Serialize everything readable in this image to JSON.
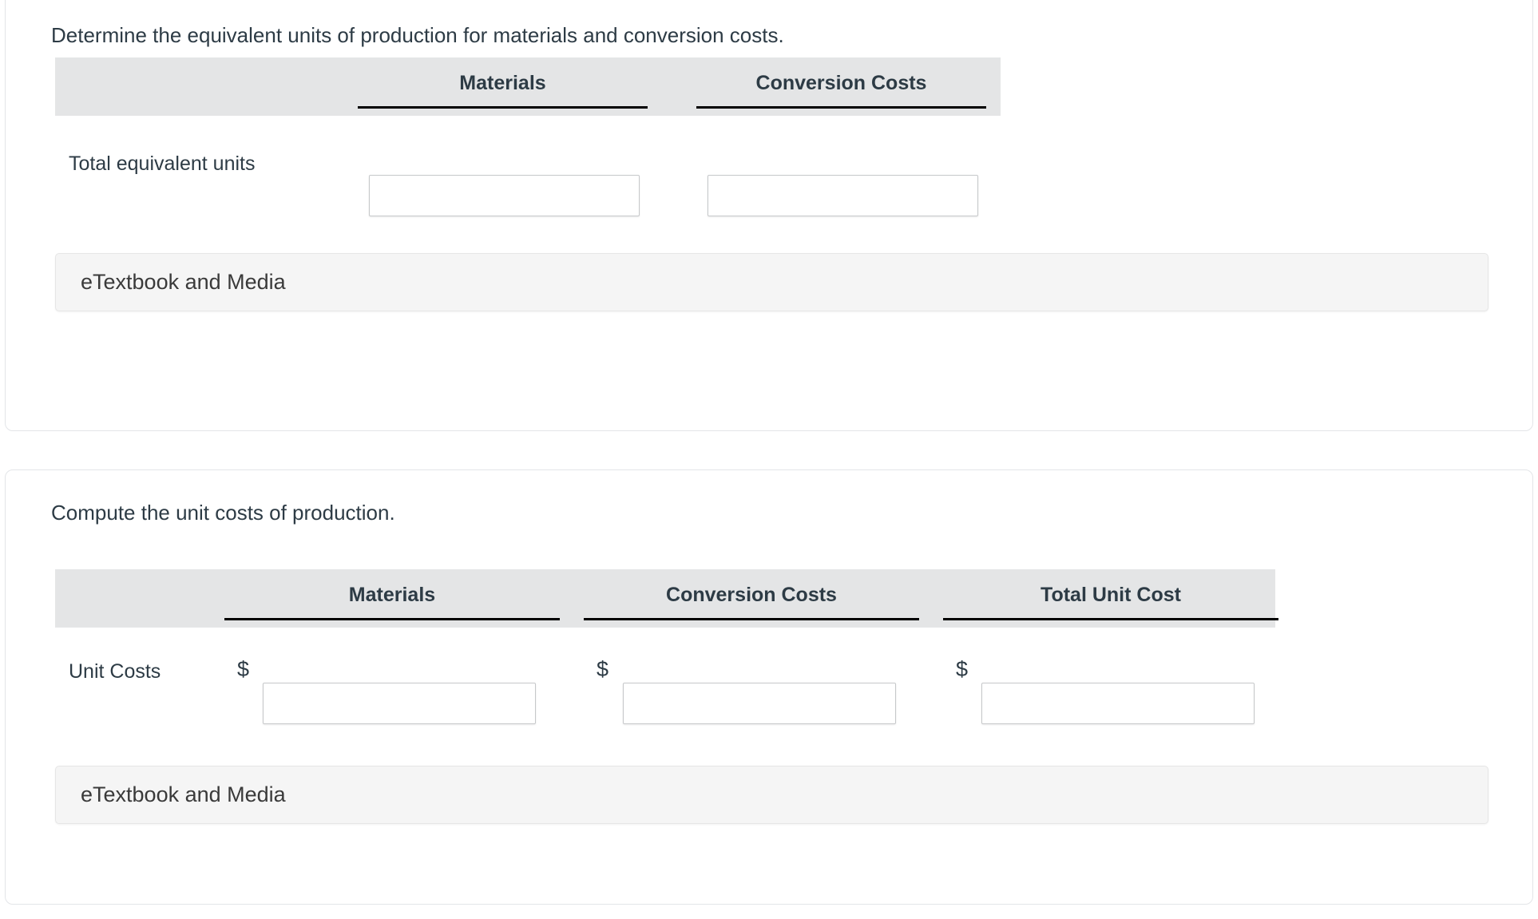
{
  "theme": {
    "text_color": "#2d3b45",
    "header_bg": "#e4e5e6",
    "card_border": "#e3e5e8",
    "input_border": "#c6c8ca",
    "etextbook_bg": "#f5f5f5",
    "rule_color": "#000000"
  },
  "sections": [
    {
      "id": "equivalent-units",
      "prompt": "Determine the equivalent units of production for materials and conversion costs.",
      "table": {
        "columns": [
          "",
          "Materials",
          "Conversion Costs"
        ],
        "rows": [
          {
            "label": "Total equivalent units",
            "cells": [
              {
                "prefix": "",
                "value": "",
                "placeholder": ""
              },
              {
                "prefix": "",
                "value": "",
                "placeholder": ""
              }
            ]
          }
        ]
      },
      "etextbook_label": "eTextbook and Media"
    },
    {
      "id": "unit-costs",
      "prompt": "Compute the unit costs of production.",
      "table": {
        "columns": [
          "",
          "Materials",
          "Conversion Costs",
          "Total Unit Cost"
        ],
        "rows": [
          {
            "label": "Unit Costs",
            "cells": [
              {
                "prefix": "$",
                "value": "",
                "placeholder": ""
              },
              {
                "prefix": "$",
                "value": "",
                "placeholder": ""
              },
              {
                "prefix": "$",
                "value": "",
                "placeholder": ""
              }
            ]
          }
        ]
      },
      "etextbook_label": "eTextbook and Media"
    }
  ]
}
